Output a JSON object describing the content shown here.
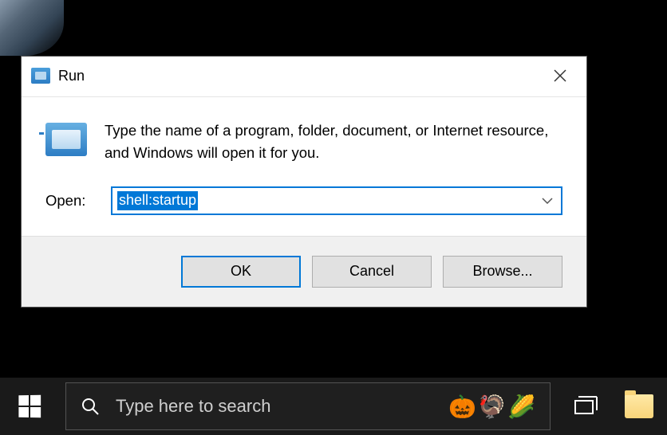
{
  "dialog": {
    "title": "Run",
    "description": "Type the name of a program, folder, document, or Internet resource, and Windows will open it for you.",
    "open_label": "Open:",
    "input_value": "shell:startup",
    "buttons": {
      "ok": "OK",
      "cancel": "Cancel",
      "browse": "Browse..."
    }
  },
  "taskbar": {
    "search_placeholder": "Type here to search",
    "emojis": [
      "🎃",
      "🦃",
      "🌽"
    ]
  }
}
